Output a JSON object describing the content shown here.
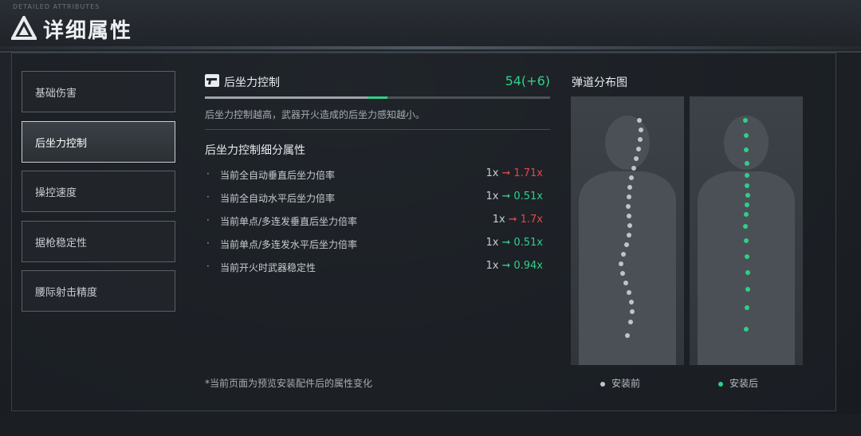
{
  "header": {
    "title": "详细属性",
    "tiny_text": "DETAILED ATTRIBUTES"
  },
  "sidebar": {
    "items": [
      {
        "label": "基础伤害",
        "active": false
      },
      {
        "label": "后坐力控制",
        "active": true
      },
      {
        "label": "操控速度",
        "active": false
      },
      {
        "label": "据枪稳定性",
        "active": false
      },
      {
        "label": "腰际射击精度",
        "active": false
      }
    ]
  },
  "stat": {
    "icon": "pistol-icon",
    "name": "后坐力控制",
    "value": "54(+6)",
    "bar_base_fraction": 0.47,
    "bar_bonus_fraction": 0.06,
    "description": "后坐力控制越高，武器开火造成的后坐力感知越小。"
  },
  "sub_attributes": {
    "title": "后坐力控制细分属性",
    "rows": [
      {
        "bullet": "·",
        "label": "当前全自动垂直后坐力倍率",
        "base": "1x",
        "arrow": "➞",
        "value": "1.71x",
        "trend": "up"
      },
      {
        "bullet": "·",
        "label": "当前全自动水平后坐力倍率",
        "base": "1x",
        "arrow": "➞",
        "value": "0.51x",
        "trend": "down"
      },
      {
        "bullet": "·",
        "label": "当前单点/多连发垂直后坐力倍率",
        "base": "1x",
        "arrow": "➞",
        "value": "1.7x",
        "trend": "up"
      },
      {
        "bullet": "·",
        "label": "当前单点/多连发水平后坐力倍率",
        "base": "1x",
        "arrow": "➞",
        "value": "0.51x",
        "trend": "down"
      },
      {
        "bullet": "·",
        "label": "当前开火时武器稳定性",
        "base": "1x",
        "arrow": "➞",
        "value": "0.94x",
        "trend": "down"
      }
    ]
  },
  "footnote": "*当前页面为预览安装配件后的属性变化",
  "pattern": {
    "title": "弹道分布图",
    "before_label": "安装前",
    "after_label": "安装后",
    "before_color": "#bfc4c9",
    "after_color": "#2fcf88"
  },
  "colors": {
    "positive": "#2fcf88",
    "negative": "#e04848"
  }
}
